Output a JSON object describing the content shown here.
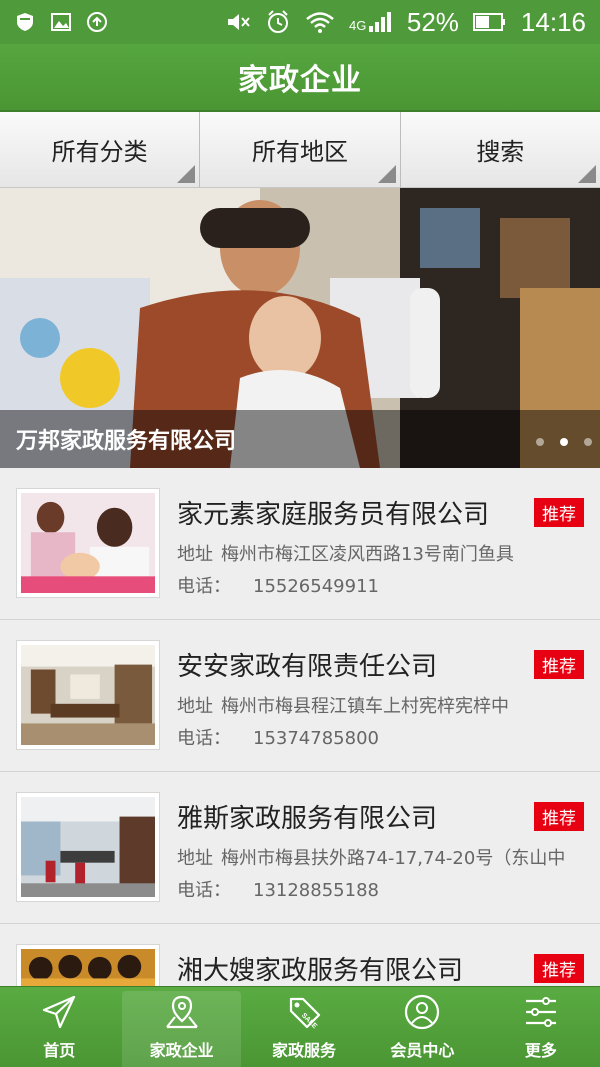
{
  "status_bar": {
    "battery": "52%",
    "time": "14:16",
    "network": "4G"
  },
  "header": {
    "title": "家政企业"
  },
  "filters": [
    {
      "label": "所有分类"
    },
    {
      "label": "所有地区"
    },
    {
      "label": "搜索"
    }
  ],
  "banner": {
    "caption": "万邦家政服务有限公司"
  },
  "badge_label": "推荐",
  "labels": {
    "address": "地址",
    "phone": "电话："
  },
  "companies": [
    {
      "name": "家元素家庭服务员有限公司",
      "address": "梅州市梅江区凌风西路13号南门鱼具",
      "phone": "15526549911"
    },
    {
      "name": "安安家政有限责任公司",
      "address": "梅州市梅县程江镇车上村宪梓宪梓中",
      "phone": "15374785800"
    },
    {
      "name": "雅斯家政服务有限公司",
      "address": "梅州市梅县扶外路74-17,74-20号（东山中",
      "phone": "13128855188"
    },
    {
      "name": "湘大嫂家政服务有限公司",
      "address": "",
      "phone": ""
    }
  ],
  "bottom_nav": [
    {
      "label": "首页",
      "icon": "send-icon"
    },
    {
      "label": "家政企业",
      "icon": "map-pin-icon",
      "active": true
    },
    {
      "label": "家政服务",
      "icon": "tag-icon"
    },
    {
      "label": "会员中心",
      "icon": "user-icon"
    },
    {
      "label": "更多",
      "icon": "sliders-icon"
    }
  ],
  "colors": {
    "brand_green": "#4f9a3a",
    "badge_red": "#e60012"
  }
}
